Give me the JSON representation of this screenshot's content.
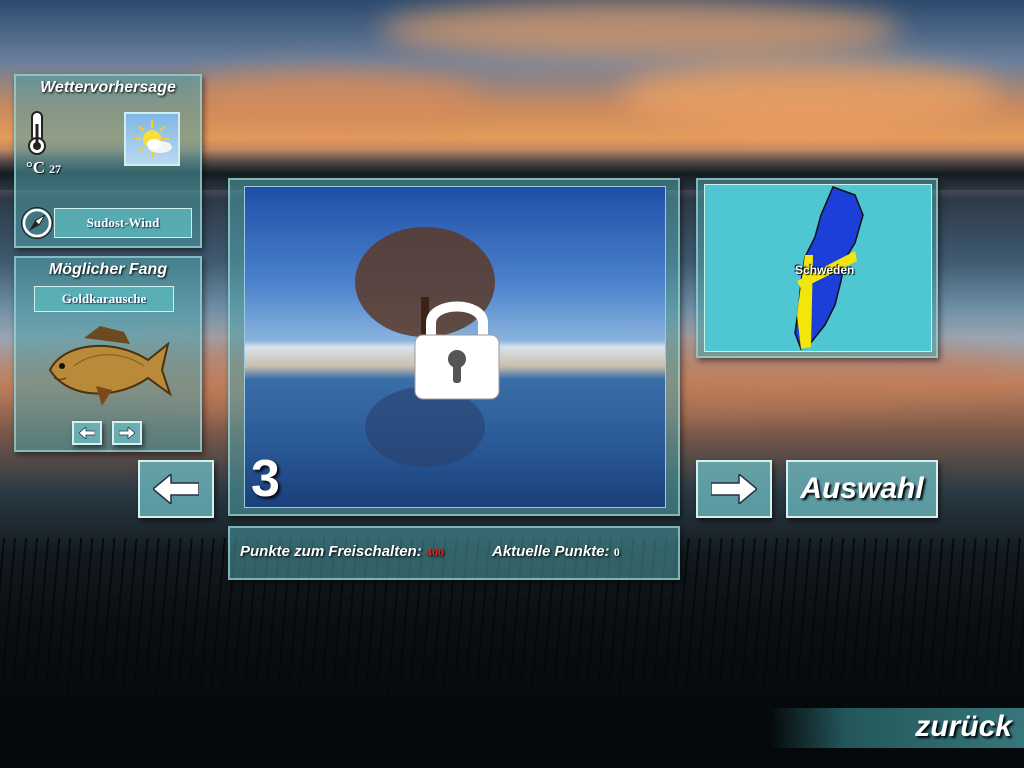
{
  "weather": {
    "title": "Wettervorhersage",
    "temp_unit": "°C",
    "temp_value": "27",
    "wind_label": "Sudost-Wind",
    "icons": [
      "thermometer-icon",
      "sun-cloud-icon",
      "compass-icon"
    ]
  },
  "catch": {
    "title": "Möglicher Fang",
    "fish_name": "Goldkarausche",
    "icons": [
      "fish-image",
      "arrow-left-icon",
      "arrow-right-icon"
    ]
  },
  "location": {
    "number": "3",
    "locked": true,
    "country": "Schweden"
  },
  "points": {
    "unlock_label": "Punkte zum Freischalten:",
    "unlock_value": "400",
    "current_label": "Aktuelle Punkte:",
    "current_value": "0"
  },
  "buttons": {
    "select": "Auswahl",
    "back": "zurück"
  },
  "colors": {
    "panel": "#4ea0a8",
    "unlock_value": "#e02020",
    "sweden_blue": "#1b3fd8",
    "sweden_yellow": "#f2e60a",
    "map_bg": "#4fc7d2"
  }
}
